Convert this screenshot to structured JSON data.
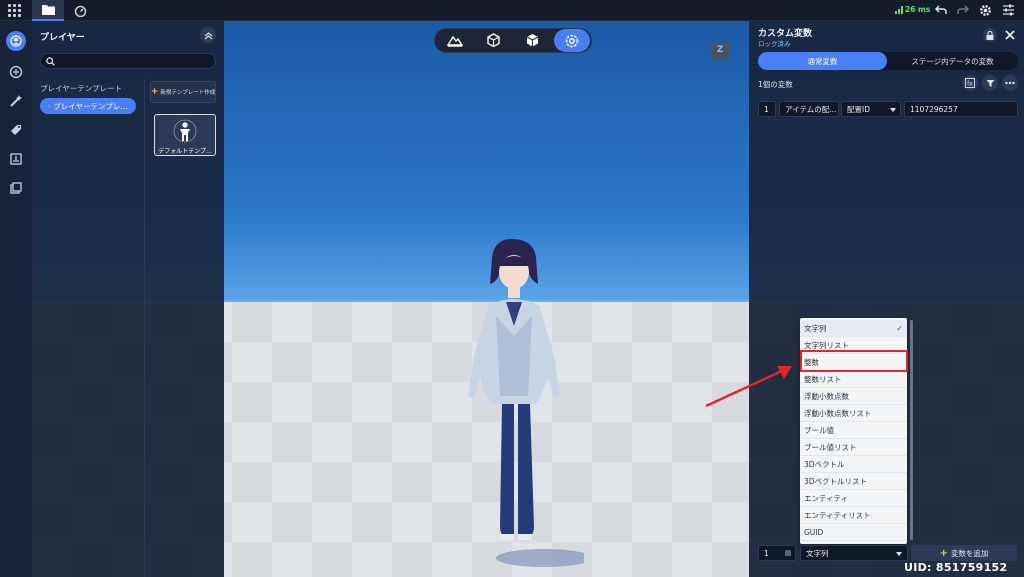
{
  "topbar": {
    "ping": "26 ms"
  },
  "left_panel": {
    "title": "プレイヤー",
    "search_placeholder": "",
    "template_label": "プレイヤーテンプレート",
    "template_chip": "プレイヤーテンプレ...",
    "new_template_button": "新規テンプレート作成",
    "card_label": "デフォルトテンプ..."
  },
  "viewport": {
    "z_badge": "Z"
  },
  "right_panel": {
    "title": "カスタム変数",
    "subtitle": "ロック済み",
    "tabs": [
      {
        "label": "通常変数",
        "active": true
      },
      {
        "label": "ステージ内データの変数",
        "active": false
      }
    ],
    "count_label": "1個の変数",
    "row": {
      "index": "1",
      "name": "アイテムの配...",
      "type": "配置ID",
      "value": "1107296257"
    },
    "dropdown": {
      "selected": "文字列",
      "check": "✓",
      "options": [
        "文字列",
        "文字列リスト",
        "整数",
        "整数リスト",
        "浮動小数点数",
        "浮動小数点数リスト",
        "ブール値",
        "ブール値リスト",
        "3Dベクトル",
        "3Dベクトルリスト",
        "エンティティ",
        "エンティティリスト",
        "GUID"
      ],
      "highlighted": "整数"
    },
    "bottom": {
      "index": "1",
      "type_value": "文字列",
      "add_button": "変数を追加"
    }
  },
  "footer": {
    "uid": "UID: 851759152"
  },
  "colors": {
    "accent": "#4b7ff7",
    "highlight": "#e5242c",
    "ping": "#5ee36a"
  }
}
